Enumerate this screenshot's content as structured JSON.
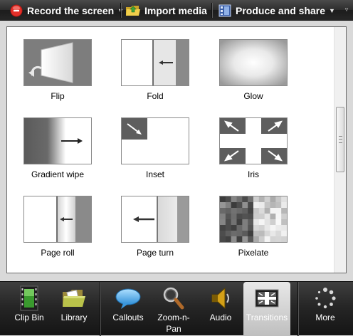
{
  "toolbar": {
    "record_label": "Record the screen",
    "import_label": "Import media",
    "produce_label": "Produce and share"
  },
  "transitions": [
    {
      "name": "Flip",
      "icon": "flip-thumbnail"
    },
    {
      "name": "Fold",
      "icon": "fold-thumbnail"
    },
    {
      "name": "Glow",
      "icon": "glow-thumbnail"
    },
    {
      "name": "Gradient wipe",
      "icon": "gradient-wipe-thumbnail"
    },
    {
      "name": "Inset",
      "icon": "inset-thumbnail"
    },
    {
      "name": "Iris",
      "icon": "iris-thumbnail"
    },
    {
      "name": "Page roll",
      "icon": "page-roll-thumbnail"
    },
    {
      "name": "Page turn",
      "icon": "page-turn-thumbnail"
    },
    {
      "name": "Pixelate",
      "icon": "pixelate-thumbnail"
    }
  ],
  "tabs": [
    {
      "label": "Clip Bin",
      "icon": "film-strip-icon"
    },
    {
      "label": "Library",
      "icon": "folder-icon"
    },
    {
      "label": "Callouts",
      "icon": "speech-bubble-icon"
    },
    {
      "label": "Zoom-n-\nPan",
      "icon": "magnifier-icon"
    },
    {
      "label": "Audio",
      "icon": "speaker-icon"
    },
    {
      "label": "Transitions",
      "icon": "transitions-icon",
      "active": true
    },
    {
      "label": "More",
      "icon": "more-dots-icon"
    }
  ],
  "colors": {
    "record_red": "#d9251d",
    "toolbar_dark": "#2a2a2a",
    "panel_bg": "#ffffff"
  }
}
